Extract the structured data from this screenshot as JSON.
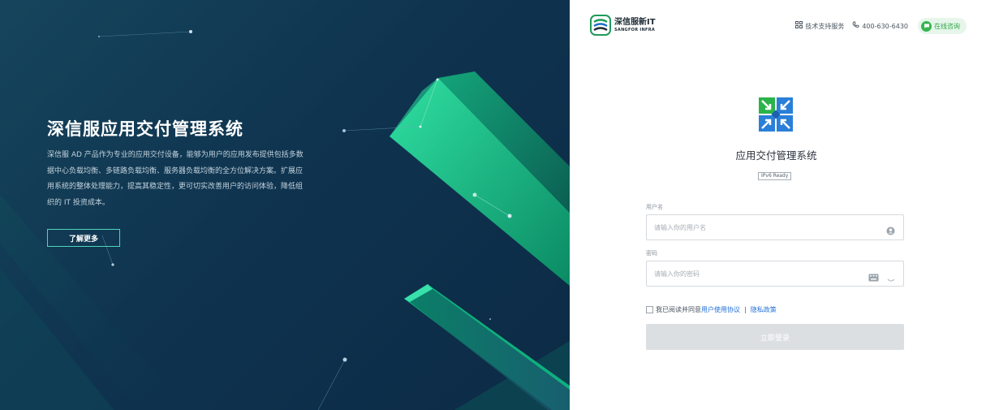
{
  "hero": {
    "title": "深信服应用交付管理系统",
    "description": "深信服 AD 产品作为专业的应用交付设备，能够为用户的应用发布提供包括多数据中心负载均衡、多链路负载均衡、服务器负载均衡的全方位解决方案。扩展应用系统的整体处理能力，提高其稳定性，更可切实改善用户的访问体验，降低组织的 IT 投资成本。",
    "button_label": "了解更多"
  },
  "brand": {
    "name": "深信服新IT",
    "subtitle": "SANGFOR INFRA"
  },
  "topbar": {
    "support_label": "技术支持服务",
    "support_icon": "grid-icon",
    "phone": "400-630-6430",
    "phone_icon": "phone-icon",
    "consult_label": "在线咨询",
    "consult_icon": "chat-icon"
  },
  "app": {
    "title": "应用交付管理系统",
    "badge": "IPv6 Ready"
  },
  "form": {
    "username_label": "用户名",
    "username_placeholder": "请输入你的用户名",
    "password_label": "密码",
    "password_placeholder": "请输入你的密码",
    "agree_prefix": "我已阅读并同意",
    "agreement_link": "用户使用协议",
    "separator": "|",
    "privacy_link": "隐私政策",
    "login_label": "立即登录"
  },
  "colors": {
    "hero_bg": "#0f3450",
    "accent_green": "#19c98a",
    "link_blue": "#1f6fd8",
    "consult_green": "#35b550",
    "login_disabled": "#dcdfe2"
  }
}
